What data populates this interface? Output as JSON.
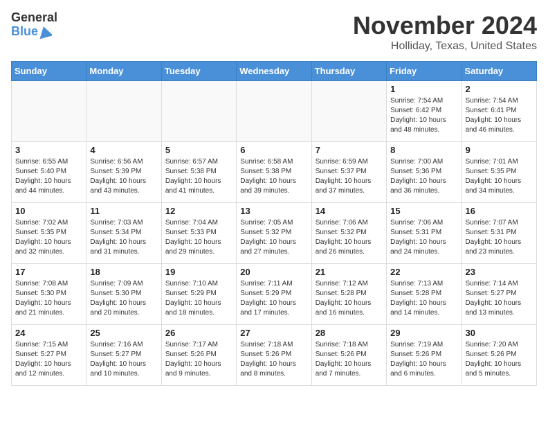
{
  "logo": {
    "general": "General",
    "blue": "Blue"
  },
  "header": {
    "month": "November 2024",
    "location": "Holliday, Texas, United States"
  },
  "days_of_week": [
    "Sunday",
    "Monday",
    "Tuesday",
    "Wednesday",
    "Thursday",
    "Friday",
    "Saturday"
  ],
  "weeks": [
    [
      {
        "day": "",
        "info": ""
      },
      {
        "day": "",
        "info": ""
      },
      {
        "day": "",
        "info": ""
      },
      {
        "day": "",
        "info": ""
      },
      {
        "day": "",
        "info": ""
      },
      {
        "day": "1",
        "info": "Sunrise: 7:54 AM\nSunset: 6:42 PM\nDaylight: 10 hours and 48 minutes."
      },
      {
        "day": "2",
        "info": "Sunrise: 7:54 AM\nSunset: 6:41 PM\nDaylight: 10 hours and 46 minutes."
      }
    ],
    [
      {
        "day": "3",
        "info": "Sunrise: 6:55 AM\nSunset: 5:40 PM\nDaylight: 10 hours and 44 minutes."
      },
      {
        "day": "4",
        "info": "Sunrise: 6:56 AM\nSunset: 5:39 PM\nDaylight: 10 hours and 43 minutes."
      },
      {
        "day": "5",
        "info": "Sunrise: 6:57 AM\nSunset: 5:38 PM\nDaylight: 10 hours and 41 minutes."
      },
      {
        "day": "6",
        "info": "Sunrise: 6:58 AM\nSunset: 5:38 PM\nDaylight: 10 hours and 39 minutes."
      },
      {
        "day": "7",
        "info": "Sunrise: 6:59 AM\nSunset: 5:37 PM\nDaylight: 10 hours and 37 minutes."
      },
      {
        "day": "8",
        "info": "Sunrise: 7:00 AM\nSunset: 5:36 PM\nDaylight: 10 hours and 36 minutes."
      },
      {
        "day": "9",
        "info": "Sunrise: 7:01 AM\nSunset: 5:35 PM\nDaylight: 10 hours and 34 minutes."
      }
    ],
    [
      {
        "day": "10",
        "info": "Sunrise: 7:02 AM\nSunset: 5:35 PM\nDaylight: 10 hours and 32 minutes."
      },
      {
        "day": "11",
        "info": "Sunrise: 7:03 AM\nSunset: 5:34 PM\nDaylight: 10 hours and 31 minutes."
      },
      {
        "day": "12",
        "info": "Sunrise: 7:04 AM\nSunset: 5:33 PM\nDaylight: 10 hours and 29 minutes."
      },
      {
        "day": "13",
        "info": "Sunrise: 7:05 AM\nSunset: 5:32 PM\nDaylight: 10 hours and 27 minutes."
      },
      {
        "day": "14",
        "info": "Sunrise: 7:06 AM\nSunset: 5:32 PM\nDaylight: 10 hours and 26 minutes."
      },
      {
        "day": "15",
        "info": "Sunrise: 7:06 AM\nSunset: 5:31 PM\nDaylight: 10 hours and 24 minutes."
      },
      {
        "day": "16",
        "info": "Sunrise: 7:07 AM\nSunset: 5:31 PM\nDaylight: 10 hours and 23 minutes."
      }
    ],
    [
      {
        "day": "17",
        "info": "Sunrise: 7:08 AM\nSunset: 5:30 PM\nDaylight: 10 hours and 21 minutes."
      },
      {
        "day": "18",
        "info": "Sunrise: 7:09 AM\nSunset: 5:30 PM\nDaylight: 10 hours and 20 minutes."
      },
      {
        "day": "19",
        "info": "Sunrise: 7:10 AM\nSunset: 5:29 PM\nDaylight: 10 hours and 18 minutes."
      },
      {
        "day": "20",
        "info": "Sunrise: 7:11 AM\nSunset: 5:29 PM\nDaylight: 10 hours and 17 minutes."
      },
      {
        "day": "21",
        "info": "Sunrise: 7:12 AM\nSunset: 5:28 PM\nDaylight: 10 hours and 16 minutes."
      },
      {
        "day": "22",
        "info": "Sunrise: 7:13 AM\nSunset: 5:28 PM\nDaylight: 10 hours and 14 minutes."
      },
      {
        "day": "23",
        "info": "Sunrise: 7:14 AM\nSunset: 5:27 PM\nDaylight: 10 hours and 13 minutes."
      }
    ],
    [
      {
        "day": "24",
        "info": "Sunrise: 7:15 AM\nSunset: 5:27 PM\nDaylight: 10 hours and 12 minutes."
      },
      {
        "day": "25",
        "info": "Sunrise: 7:16 AM\nSunset: 5:27 PM\nDaylight: 10 hours and 10 minutes."
      },
      {
        "day": "26",
        "info": "Sunrise: 7:17 AM\nSunset: 5:26 PM\nDaylight: 10 hours and 9 minutes."
      },
      {
        "day": "27",
        "info": "Sunrise: 7:18 AM\nSunset: 5:26 PM\nDaylight: 10 hours and 8 minutes."
      },
      {
        "day": "28",
        "info": "Sunrise: 7:18 AM\nSunset: 5:26 PM\nDaylight: 10 hours and 7 minutes."
      },
      {
        "day": "29",
        "info": "Sunrise: 7:19 AM\nSunset: 5:26 PM\nDaylight: 10 hours and 6 minutes."
      },
      {
        "day": "30",
        "info": "Sunrise: 7:20 AM\nSunset: 5:26 PM\nDaylight: 10 hours and 5 minutes."
      }
    ]
  ]
}
